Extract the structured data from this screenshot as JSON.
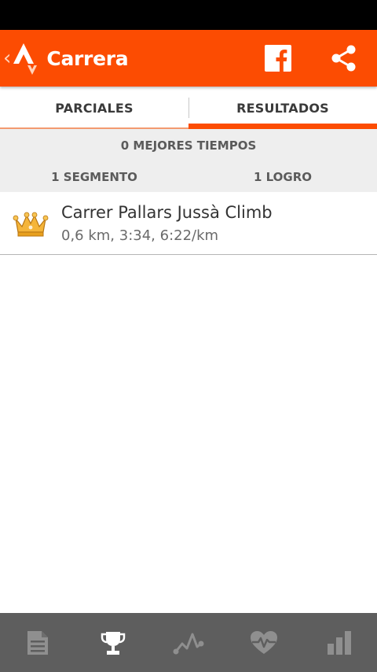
{
  "app_bar": {
    "title": "Carrera",
    "back_glyph": "‹",
    "logo_icon": "strava-logo-icon",
    "actions": [
      {
        "icon": "facebook-icon"
      },
      {
        "icon": "share-icon"
      }
    ]
  },
  "tabs": [
    {
      "label": "PARCIALES",
      "selected": false
    },
    {
      "label": "RESULTADOS",
      "selected": true
    }
  ],
  "summary": {
    "best_times": "0 MEJORES TIEMPOS",
    "segments": "1 SEGMENTO",
    "achievements": "1 LOGRO"
  },
  "efforts": [
    {
      "icon": "crown-icon",
      "name": "Carrer Pallars Jussà Climb",
      "stats": "0,6 km, 3:34, 6:22/km"
    }
  ],
  "bottom_nav": [
    {
      "icon": "document-icon",
      "selected": false
    },
    {
      "icon": "trophy-icon",
      "selected": true
    },
    {
      "icon": "elevation-icon",
      "selected": false
    },
    {
      "icon": "heart-rate-icon",
      "selected": false
    },
    {
      "icon": "bar-chart-icon",
      "selected": false
    }
  ],
  "colors": {
    "brand_orange": "#fc4c02",
    "status_bar": "#000000",
    "summary_bg": "#eeeeee",
    "bottom_nav_bg": "#5e5e5e",
    "icon_inactive": "#8f8f8f",
    "icon_active": "#ffffff"
  }
}
